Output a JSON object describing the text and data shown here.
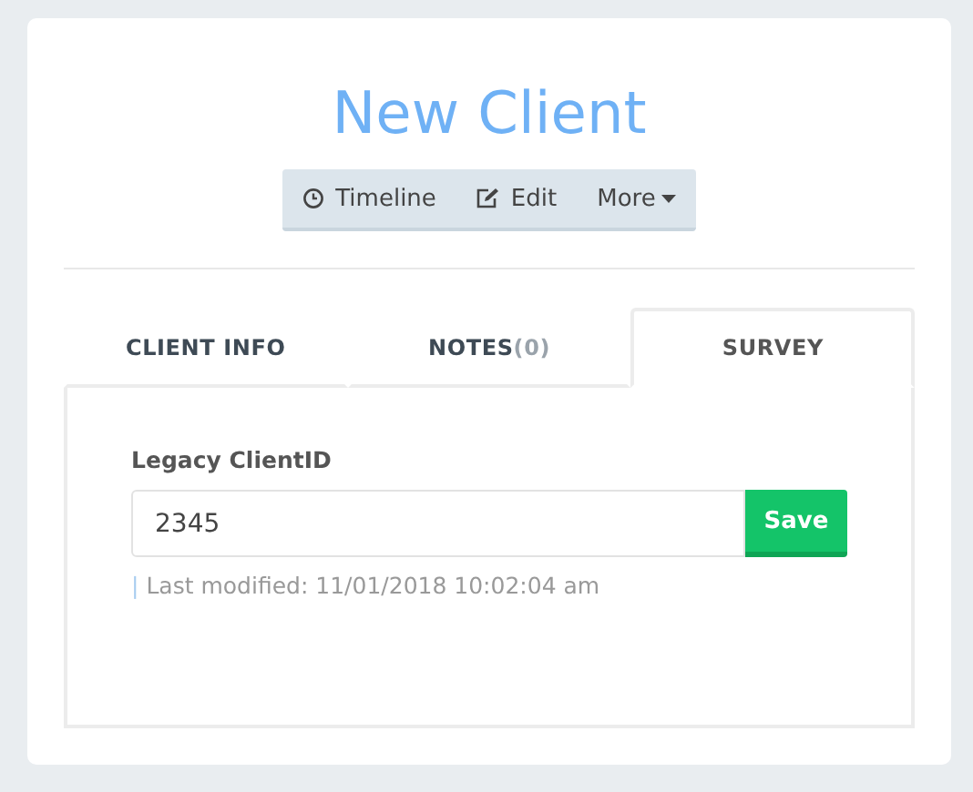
{
  "title": "New Client",
  "actions": [
    {
      "kind": "clock",
      "label": "Timeline"
    },
    {
      "kind": "edit",
      "label": "Edit"
    },
    {
      "kind": "dropdown",
      "label": "More"
    }
  ],
  "tabs": [
    {
      "label": "CLIENT INFO",
      "selected": false
    },
    {
      "label": "NOTES",
      "count": "(0)",
      "selected": false
    },
    {
      "label": "SURVEY",
      "selected": true
    }
  ],
  "form": {
    "label": "Legacy ClientID",
    "value": "2345",
    "button": "Save",
    "separator": "|",
    "modified": "Last modified: 11/01/2018 10:02:04 am"
  }
}
